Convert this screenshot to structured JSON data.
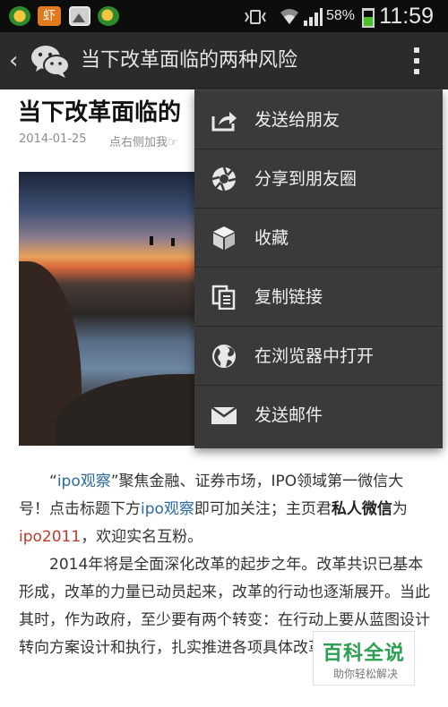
{
  "status_bar": {
    "notification_icons": [
      "wechat-icon",
      "xia-app-icon",
      "gallery-icon",
      "wechat-moments-icon"
    ],
    "xia_label": "虾",
    "battery_percent": "58%",
    "battery_level": 0.58,
    "time": "11:59",
    "system_icons": [
      "vibrate-icon",
      "wifi-icon",
      "signal-icon",
      "battery-icon"
    ]
  },
  "action_bar": {
    "title": "当下改革面临的两种风险",
    "icons": [
      "back-icon",
      "wechat-icon",
      "overflow-menu-icon"
    ]
  },
  "article": {
    "title": "当下改革面临的",
    "date": "2014-01-25",
    "follow_hint": "点右侧加我☞",
    "paragraphs": [
      {
        "segments": [
          {
            "text": "“",
            "style": "plain"
          },
          {
            "text": "ipo观察",
            "style": "link"
          },
          {
            "text": "”聚焦金融、证券市场，IPO领域第一微信大号！点击标题下方",
            "style": "plain"
          },
          {
            "text": "ipo观察",
            "style": "link"
          },
          {
            "text": "即可加关注；主页君",
            "style": "plain"
          },
          {
            "text": "私人微信",
            "style": "bold"
          },
          {
            "text": "为",
            "style": "plain"
          },
          {
            "text": "ipo2011",
            "style": "red"
          },
          {
            "text": "，欢迎实名互粉。",
            "style": "plain"
          }
        ]
      },
      {
        "text": "2014年将是全面深化改革的起步之年。改革共识已基本形成，改革的力量已动员起来，改革的行动也逐渐展开。当此其时，作为政府，至少要有两个转变：在行动上要从蓝图设计转向方案设计和执行，扎实推进各项具体改革，在思"
      }
    ]
  },
  "menu": {
    "items": [
      {
        "label": "发送给朋友",
        "icon": "share-arrow-icon"
      },
      {
        "label": "分享到朋友圈",
        "icon": "moments-aperture-icon"
      },
      {
        "label": "收藏",
        "icon": "favorite-cube-icon"
      },
      {
        "label": "复制链接",
        "icon": "copy-link-icon"
      },
      {
        "label": "在浏览器中打开",
        "icon": "globe-icon"
      },
      {
        "label": "发送邮件",
        "icon": "mail-icon"
      }
    ]
  },
  "watermark": {
    "title": "百科全说",
    "subtitle": "助你轻松解决"
  },
  "colors": {
    "action_bar_bg": "#2b2b2b",
    "menu_bg": "#3a3a3a",
    "link": "#2b6aa0",
    "highlight_red": "#c0392b",
    "watermark_green": "#2aa050",
    "battery_green": "#4cbf2f"
  }
}
